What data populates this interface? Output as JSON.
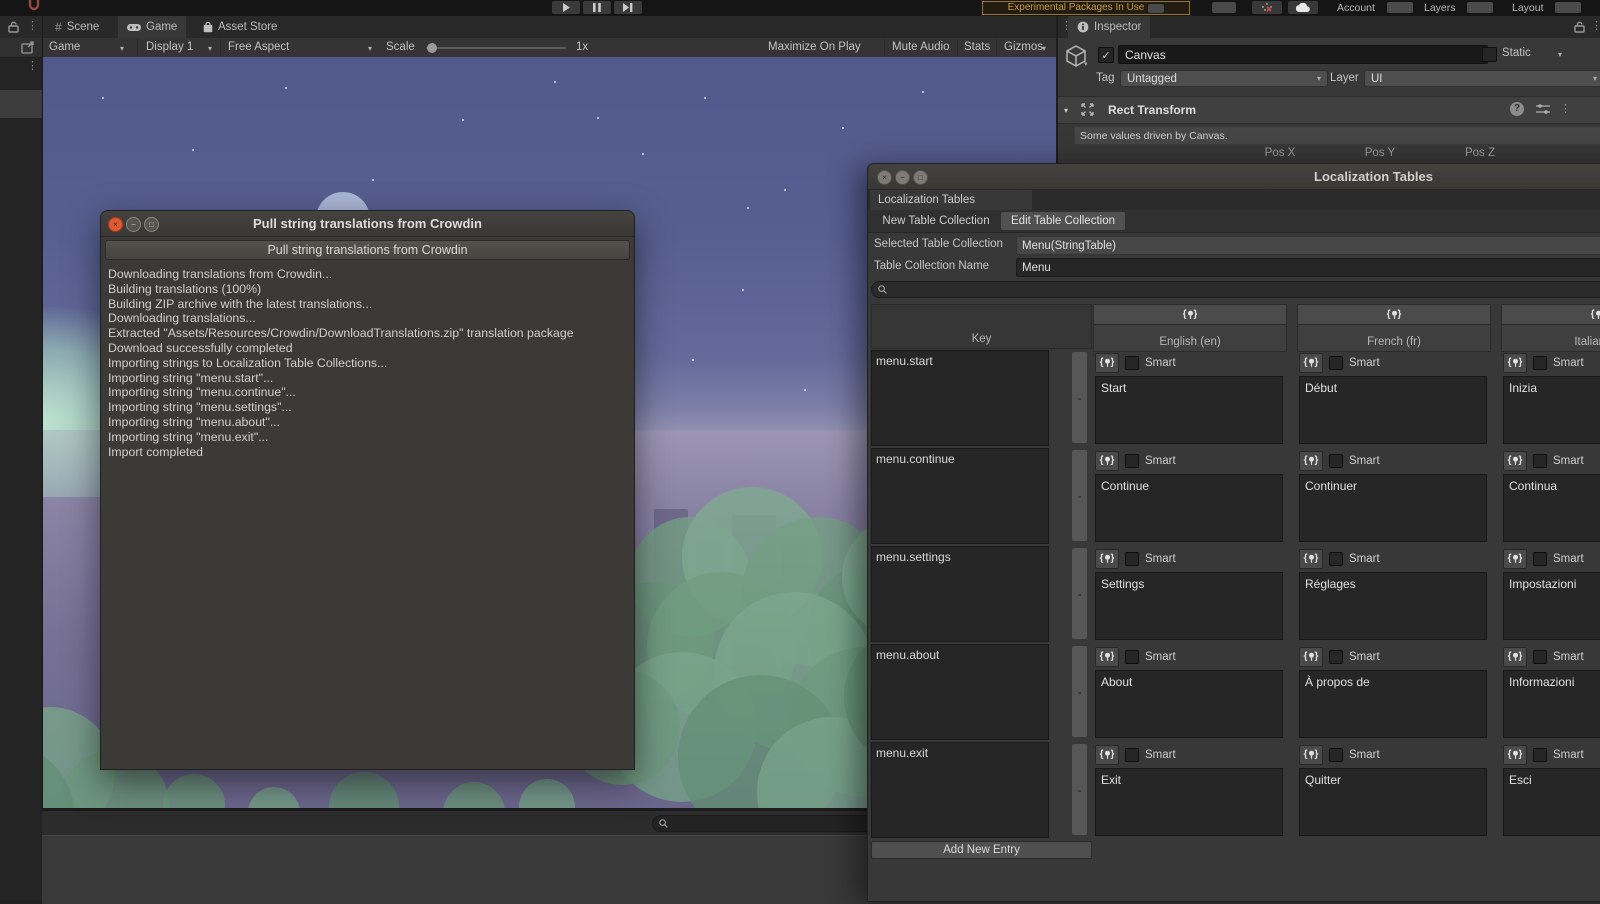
{
  "colors": {
    "accent_close": "#E0592F",
    "warning_text": "#C79A3C",
    "panel": "#383838",
    "sky_top": "#525A8C",
    "ground": "#716C93",
    "bush_green": "#6FA87C",
    "building_purple": "#5B5577"
  },
  "top_bar": {
    "warning_label": "Experimental Packages In Use",
    "account_label": "Account",
    "layers_label": "Layers",
    "layout_label": "Layout"
  },
  "game_panel": {
    "tabs": [
      {
        "label": "Scene"
      },
      {
        "label": "Game"
      },
      {
        "label": "Asset Store"
      }
    ],
    "toolbar": {
      "game_dropdown": "Game",
      "display_dropdown": "Display 1",
      "aspect_dropdown": "Free Aspect",
      "scale_label": "Scale",
      "scale_value": "1x",
      "maximize_label": "Maximize On Play",
      "mute_label": "Mute Audio",
      "stats_label": "Stats",
      "gizmos_label": "Gizmos"
    }
  },
  "crowdin_dialog": {
    "title": "Pull string translations from Crowdin",
    "action_button": "Pull string translations from Crowdin",
    "log_lines": [
      "Downloading translations from Crowdin...",
      "Building translations (100%)",
      "Building ZIP archive with the latest translations...",
      "Downloading translations...",
      "Extracted \"Assets/Resources/Crowdin/DownloadTranslations.zip\" translation package",
      "Download successfully completed",
      "Importing strings to Localization Table Collections...",
      "Importing string \"menu.start\"...",
      "Importing string \"menu.continue\"...",
      "Importing string \"menu.settings\"...",
      "Importing string \"menu.about\"...",
      "Importing string \"menu.exit\"...",
      "Import completed"
    ]
  },
  "inspector": {
    "tab_label": "Inspector",
    "object_name": "Canvas",
    "static_label": "Static",
    "tag_label": "Tag",
    "tag_value": "Untagged",
    "layer_label": "Layer",
    "layer_value": "UI",
    "component_title": "Rect Transform",
    "help_text": "Some values driven by Canvas.",
    "pos_labels": [
      "Pos X",
      "Pos Y",
      "Pos Z"
    ]
  },
  "localization_window": {
    "window_title": "Localization Tables",
    "tab_label": "Localization Tables",
    "new_button": "New Table Collection",
    "edit_button": "Edit Table Collection",
    "selected_label": "Selected Table Collection",
    "selected_value": "Menu(StringTable)",
    "name_label": "Table Collection Name",
    "name_value": "Menu",
    "key_header": "Key",
    "columns": [
      "English (en)",
      "French (fr)",
      "Italian (it)"
    ],
    "smart_label": "Smart",
    "remove_label": "-",
    "add_button": "Add New Entry",
    "rows": [
      {
        "key": "menu.start",
        "values": [
          "Start",
          "Début",
          "Inizia"
        ]
      },
      {
        "key": "menu.continue",
        "values": [
          "Continue",
          "Continuer",
          "Continua"
        ]
      },
      {
        "key": "menu.settings",
        "values": [
          "Settings",
          "Réglages",
          "Impostazioni"
        ]
      },
      {
        "key": "menu.about",
        "values": [
          "About",
          "À propos de",
          "Informazioni"
        ]
      },
      {
        "key": "menu.exit",
        "values": [
          "Exit",
          "Quitter",
          "Esci"
        ]
      }
    ]
  },
  "bottom_panel": {
    "search_value": ""
  }
}
